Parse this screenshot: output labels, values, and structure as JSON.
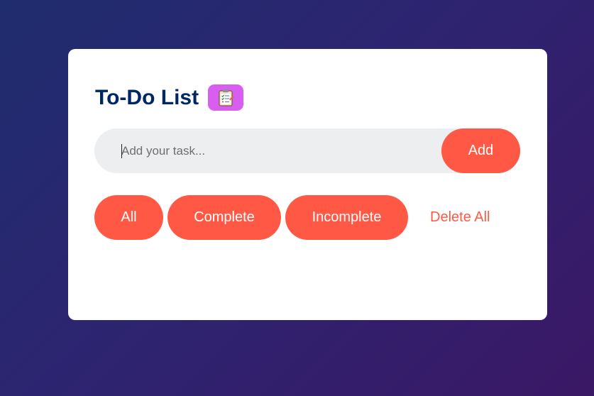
{
  "app": {
    "title": "To-Do List",
    "title_icon": "clipboard-checklist-icon"
  },
  "task_input": {
    "value": "",
    "placeholder": "Add your task..."
  },
  "add_button": {
    "label": "Add"
  },
  "filters": [
    {
      "label": "All"
    },
    {
      "label": "Complete"
    },
    {
      "label": "Incomplete"
    }
  ],
  "delete_all": {
    "label": "Delete All"
  },
  "colors": {
    "accent": "#ff5945",
    "title": "#002765",
    "icon_bg": "#d85ef0",
    "input_bg": "#edeef0",
    "bg_start": "#1f2d6e",
    "bg_end": "#3a1866"
  }
}
